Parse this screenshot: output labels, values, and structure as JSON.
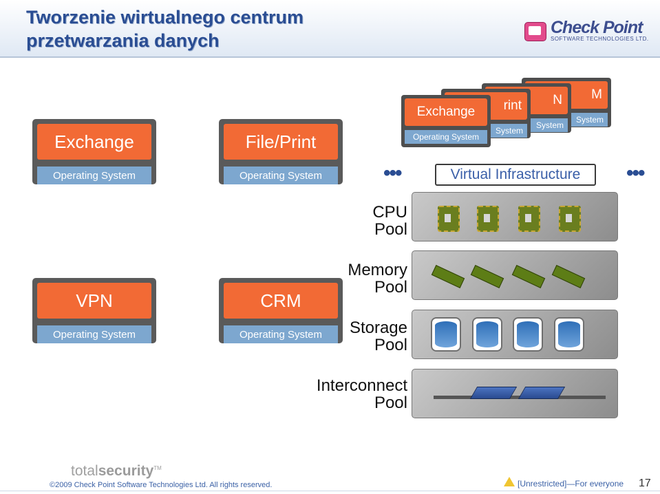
{
  "header": {
    "title_line1": "Tworzenie wirtualnego centrum",
    "title_line2": "przetwarzania danych",
    "logo_text": "Check Point",
    "logo_sub": "SOFTWARE TECHNOLOGIES LTD."
  },
  "left_vms": [
    {
      "app": "Exchange",
      "os": "Operating System"
    },
    {
      "app": "File/Print",
      "os": "Operating System"
    },
    {
      "app": "VPN",
      "os": "Operating System"
    },
    {
      "app": "CRM",
      "os": "Operating System"
    }
  ],
  "stack": {
    "front_app": "Exchange",
    "front_os": "Operating System",
    "back1_app": "rint",
    "back1_os": "System",
    "back2_app": "N",
    "back2_os": "System",
    "back3_app": "M",
    "back3_os": "System"
  },
  "ellipsis": "•••",
  "virtual_infra": "Virtual Infrastructure",
  "pools": {
    "cpu": "CPU\nPool",
    "memory": "Memory\nPool",
    "storage": "Storage\nPool",
    "interconnect": "Interconnect\nPool"
  },
  "footer": {
    "brand_left": "total",
    "brand_right": "security",
    "tm": "TM",
    "copyright": "©2009 Check Point Software Technologies Ltd. All rights reserved.",
    "classification": "[Unrestricted]—For everyone",
    "page": "17"
  }
}
